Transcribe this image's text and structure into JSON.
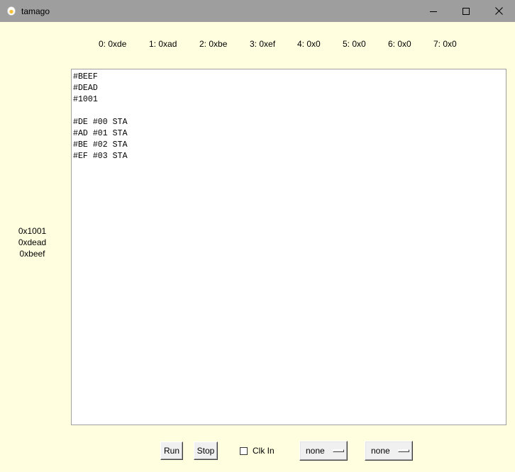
{
  "window": {
    "title": "tamago",
    "controls": {
      "minimize": "minimize-icon",
      "maximize": "maximize-icon",
      "close": "close-icon"
    }
  },
  "registers": [
    {
      "label": "0: 0xde"
    },
    {
      "label": "1: 0xad"
    },
    {
      "label": "2: 0xbe"
    },
    {
      "label": "3: 0xef"
    },
    {
      "label": "4: 0x0"
    },
    {
      "label": "5: 0x0"
    },
    {
      "label": "6: 0x0"
    },
    {
      "label": "7: 0x0"
    }
  ],
  "stack": [
    "0x1001",
    "0xdead",
    "0xbeef"
  ],
  "editor": {
    "code": "#BEEF\n#DEAD\n#1001\n\n#DE #00 STA\n#AD #01 STA\n#BE #02 STA\n#EF #03 STA"
  },
  "controls": {
    "run_label": "Run",
    "stop_label": "Stop",
    "clk_in_label": "Clk In",
    "clk_in_checked": false,
    "menu1_value": "none",
    "menu2_value": "none"
  },
  "colors": {
    "background": "#ffffe0",
    "titlebar": "#9e9e9e",
    "button_face": "#f0f0f0",
    "editor_background": "#ffffff"
  }
}
